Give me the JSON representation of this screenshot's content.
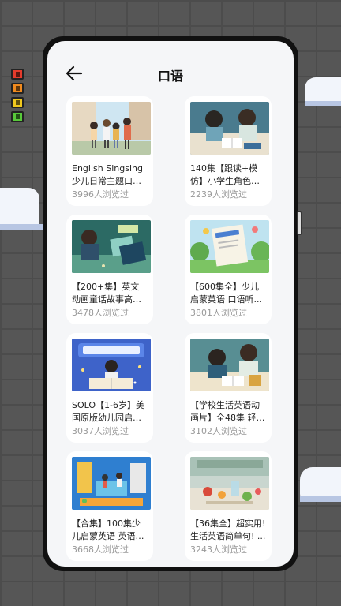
{
  "header": {
    "title": "口语",
    "back_icon": "arrow-left-icon"
  },
  "theme": {
    "screen_bg": "#f5f6f8",
    "card_bg": "#ffffff",
    "title_color": "#222222",
    "meta_color": "#999999",
    "page_bg": "#565656"
  },
  "decor": {
    "lights": [
      "red",
      "orange",
      "yellow",
      "green"
    ]
  },
  "cards": [
    {
      "title": "English Singsing少儿日常主题口语【...",
      "views": "3996人浏览过",
      "thumb": "kids-on-street"
    },
    {
      "title": "140集【跟读+模仿】小学生角色扮...",
      "views": "2239人浏览过",
      "thumb": "kids-reading-desk"
    },
    {
      "title": "【200+集】英文动画童话故事高清合...",
      "views": "3478人浏览过",
      "thumb": "boy-with-books"
    },
    {
      "title": "【600集全】少儿启蒙英语 口语听...",
      "views": "3801人浏览过",
      "thumb": "english-book-garden"
    },
    {
      "title": "SOLO【1-6岁】美国原版幼儿园启蒙英...",
      "views": "3037人浏览过",
      "thumb": "english-title-boy"
    },
    {
      "title": "【学校生活英语动画片】全48集 轻松...",
      "views": "3102人浏览过",
      "thumb": "kids-reading-desk-2"
    },
    {
      "title": "【合集】100集少儿启蒙英语 英语动...",
      "views": "3668人浏览过",
      "thumb": "classroom-illustration"
    },
    {
      "title": "【36集全】超实用!生活英语简单句! ...",
      "views": "3243人浏览过",
      "thumb": "kitchen-cooking"
    }
  ]
}
